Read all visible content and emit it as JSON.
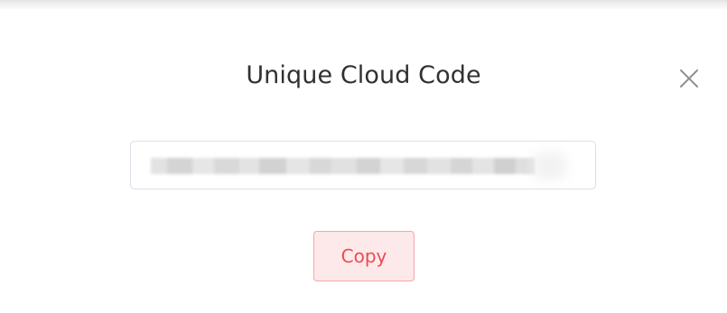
{
  "dialog": {
    "title": "Unique Cloud Code",
    "close_icon": "close-icon",
    "code_field": {
      "value": "",
      "redacted": true
    },
    "copy_label": "Copy"
  },
  "colors": {
    "title": "#303133",
    "close_icon": "#8f8f8f",
    "input_border": "#dcdfe6",
    "copy_background": "#fde9ea",
    "copy_border": "#f7a6a9",
    "copy_text": "#ec4b52"
  }
}
